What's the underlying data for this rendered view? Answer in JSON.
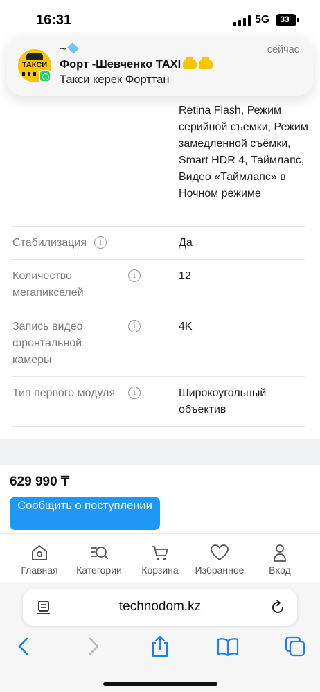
{
  "status_bar": {
    "time": "16:31",
    "network": "5G",
    "battery": "33"
  },
  "notification": {
    "sender_line": "~",
    "title": "Форт -Шевченко TAXI",
    "body": "Такси керек Форттан",
    "time": "сейчас",
    "avatar_text": "ТАКСИ",
    "app_icon": "whatsapp-icon"
  },
  "specs": {
    "continued_value": "Retina Flash, Режим серийной съемки, Режим замедленной съёмки, Smart HDR 4, Таймлапс, Видео «Таймлапс» в Ночном режиме",
    "rows": [
      {
        "label": "Стабилизация",
        "value": "Да"
      },
      {
        "label": "Количество мегапикселей",
        "value": "12"
      },
      {
        "label": "Запись видео фронтальной камеры",
        "value": "4K"
      },
      {
        "label": "Тип первого модуля",
        "value": "Широкоугольный объектив"
      }
    ]
  },
  "product": {
    "price": "629 990 ₸",
    "notify_button": "Сообщить о поступлении"
  },
  "site_nav": {
    "items": [
      {
        "label": "Главная",
        "icon": "home-icon"
      },
      {
        "label": "Категории",
        "icon": "categories-search-icon"
      },
      {
        "label": "Корзина",
        "icon": "cart-icon"
      },
      {
        "label": "Избранное",
        "icon": "heart-icon"
      },
      {
        "label": "Вход",
        "icon": "user-icon"
      }
    ]
  },
  "browser": {
    "url": "technodom.kz",
    "accent_color": "#1f7ef0"
  },
  "colors": {
    "primary_button": "#1f97f4",
    "label_gray": "#7c7c7c"
  }
}
